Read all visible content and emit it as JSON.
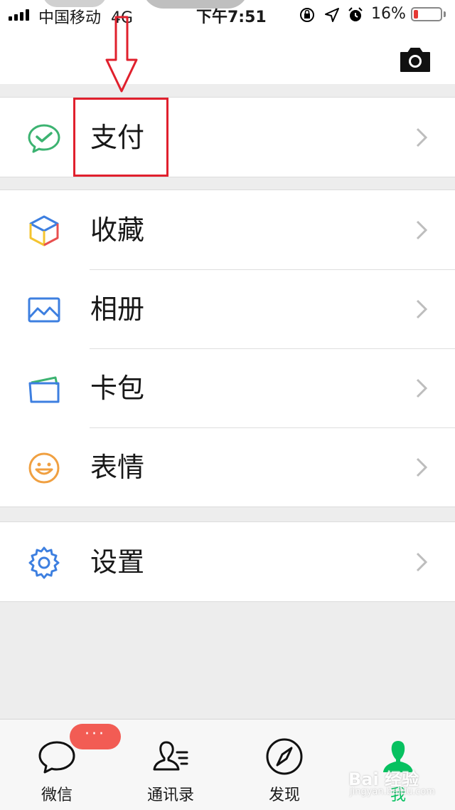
{
  "status_bar": {
    "carrier": "中国移动",
    "network": "4G",
    "time": "下午7:51",
    "battery_percent": "16%",
    "battery_level": 0.16,
    "battery_color": "#e53935"
  },
  "header": {
    "camera_icon": "camera-icon"
  },
  "menu": {
    "pay": {
      "label": "支付",
      "icon": "wechat-pay-icon",
      "color": "#3cb371"
    },
    "favorites": {
      "label": "收藏",
      "icon": "favorites-cube-icon"
    },
    "album": {
      "label": "相册",
      "icon": "album-icon",
      "color": "#3d7fe0"
    },
    "cards": {
      "label": "卡包",
      "icon": "card-wallet-icon",
      "color": "#3d7fe0"
    },
    "stickers": {
      "label": "表情",
      "icon": "smiley-icon",
      "color": "#f0a041"
    },
    "settings": {
      "label": "设置",
      "icon": "gear-icon",
      "color": "#3d7fe0"
    }
  },
  "tab_bar": {
    "tabs": [
      {
        "label": "微信",
        "icon": "chat-bubble-icon"
      },
      {
        "label": "通讯录",
        "icon": "contacts-icon"
      },
      {
        "label": "发现",
        "icon": "compass-icon"
      },
      {
        "label": "我",
        "icon": "person-icon",
        "active": true
      }
    ],
    "badge": "···",
    "accent": "#07c160"
  },
  "annotation": {
    "highlight_color": "#e0202d"
  },
  "watermark": {
    "text": "Bai 经验",
    "sub": "jingyan.baidu.com"
  }
}
